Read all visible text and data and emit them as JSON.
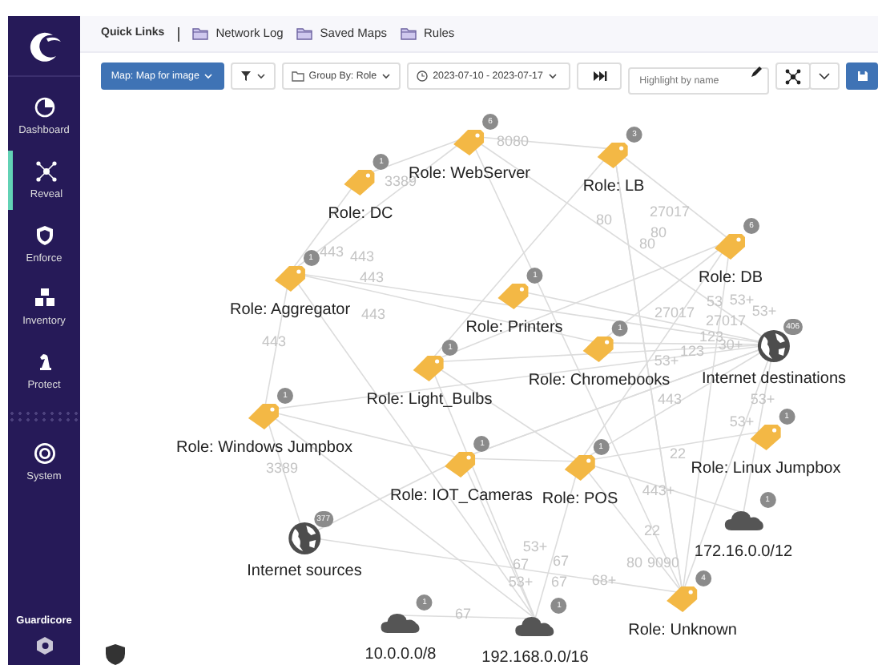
{
  "quick_links": {
    "title": "Quick Links",
    "items": [
      "Network Log",
      "Saved Maps",
      "Rules"
    ]
  },
  "sidebar": {
    "items": [
      {
        "label": "Dashboard",
        "selected": false
      },
      {
        "label": "Reveal",
        "selected": true
      },
      {
        "label": "Enforce",
        "selected": false
      },
      {
        "label": "Inventory",
        "selected": false
      },
      {
        "label": "Protect",
        "selected": false
      },
      {
        "label": "System",
        "selected": false
      }
    ],
    "brand": "Guardicore"
  },
  "toolbar": {
    "map_button": "Map: Map for image",
    "group_by": "Group By: Role",
    "date_range": "2023-07-10 - 2023-07-17",
    "highlight": {
      "placeholder": "Highlight by name"
    }
  },
  "map": {
    "nodes": [
      {
        "label": "Role: WebServer",
        "kind": "role",
        "count": "6"
      },
      {
        "label": "Role: LB",
        "kind": "role",
        "count": "3"
      },
      {
        "label": "Role: DC",
        "kind": "role",
        "count": "1"
      },
      {
        "label": "Role: DB",
        "kind": "role",
        "count": "6"
      },
      {
        "label": "Role: Aggregator",
        "kind": "role",
        "count": "1"
      },
      {
        "label": "Role: Printers",
        "kind": "role",
        "count": "1"
      },
      {
        "label": "Role: Light_Bulbs",
        "kind": "role",
        "count": "1"
      },
      {
        "label": "Role: Chromebooks",
        "kind": "role",
        "count": "1"
      },
      {
        "label": "Internet destinations",
        "kind": "internet",
        "count": "406"
      },
      {
        "label": "Role: Windows Jumpbox",
        "kind": "role",
        "count": "1"
      },
      {
        "label": "Role: Linux Jumpbox",
        "kind": "role",
        "count": "1"
      },
      {
        "label": "Role: IOT_Cameras",
        "kind": "role",
        "count": "1"
      },
      {
        "label": "Role: POS",
        "kind": "role",
        "count": "1"
      },
      {
        "label": "Internet sources",
        "kind": "internet",
        "count": "377"
      },
      {
        "label": "172.16.0.0/12",
        "kind": "subnet",
        "count": "1"
      },
      {
        "label": "Role: Unknown",
        "kind": "role",
        "count": "4"
      },
      {
        "label": "10.0.0.0/8",
        "kind": "subnet",
        "count": "1"
      },
      {
        "label": "192.168.0.0/16",
        "kind": "subnet",
        "count": "1"
      }
    ],
    "edges": [
      {
        "label": "8080"
      },
      {
        "label": "3389"
      },
      {
        "label": "80"
      },
      {
        "label": "27017"
      },
      {
        "label": "80"
      },
      {
        "label": "443"
      },
      {
        "label": "80"
      },
      {
        "label": "443"
      },
      {
        "label": "443"
      },
      {
        "label": "443"
      },
      {
        "label": "27017"
      },
      {
        "label": "53"
      },
      {
        "label": "27017"
      },
      {
        "label": "53+"
      },
      {
        "label": "53+"
      },
      {
        "label": "443"
      },
      {
        "label": "53+"
      },
      {
        "label": "123"
      },
      {
        "label": "123"
      },
      {
        "label": "30+"
      },
      {
        "label": "443"
      },
      {
        "label": "53+"
      },
      {
        "label": "53+"
      },
      {
        "label": "22"
      },
      {
        "label": "3389"
      },
      {
        "label": "443+"
      },
      {
        "label": "22"
      },
      {
        "label": "53+"
      },
      {
        "label": "67"
      },
      {
        "label": "67"
      },
      {
        "label": "80"
      },
      {
        "label": "9090"
      },
      {
        "label": "53+"
      },
      {
        "label": "67"
      },
      {
        "label": "68+"
      },
      {
        "label": "67"
      }
    ]
  }
}
